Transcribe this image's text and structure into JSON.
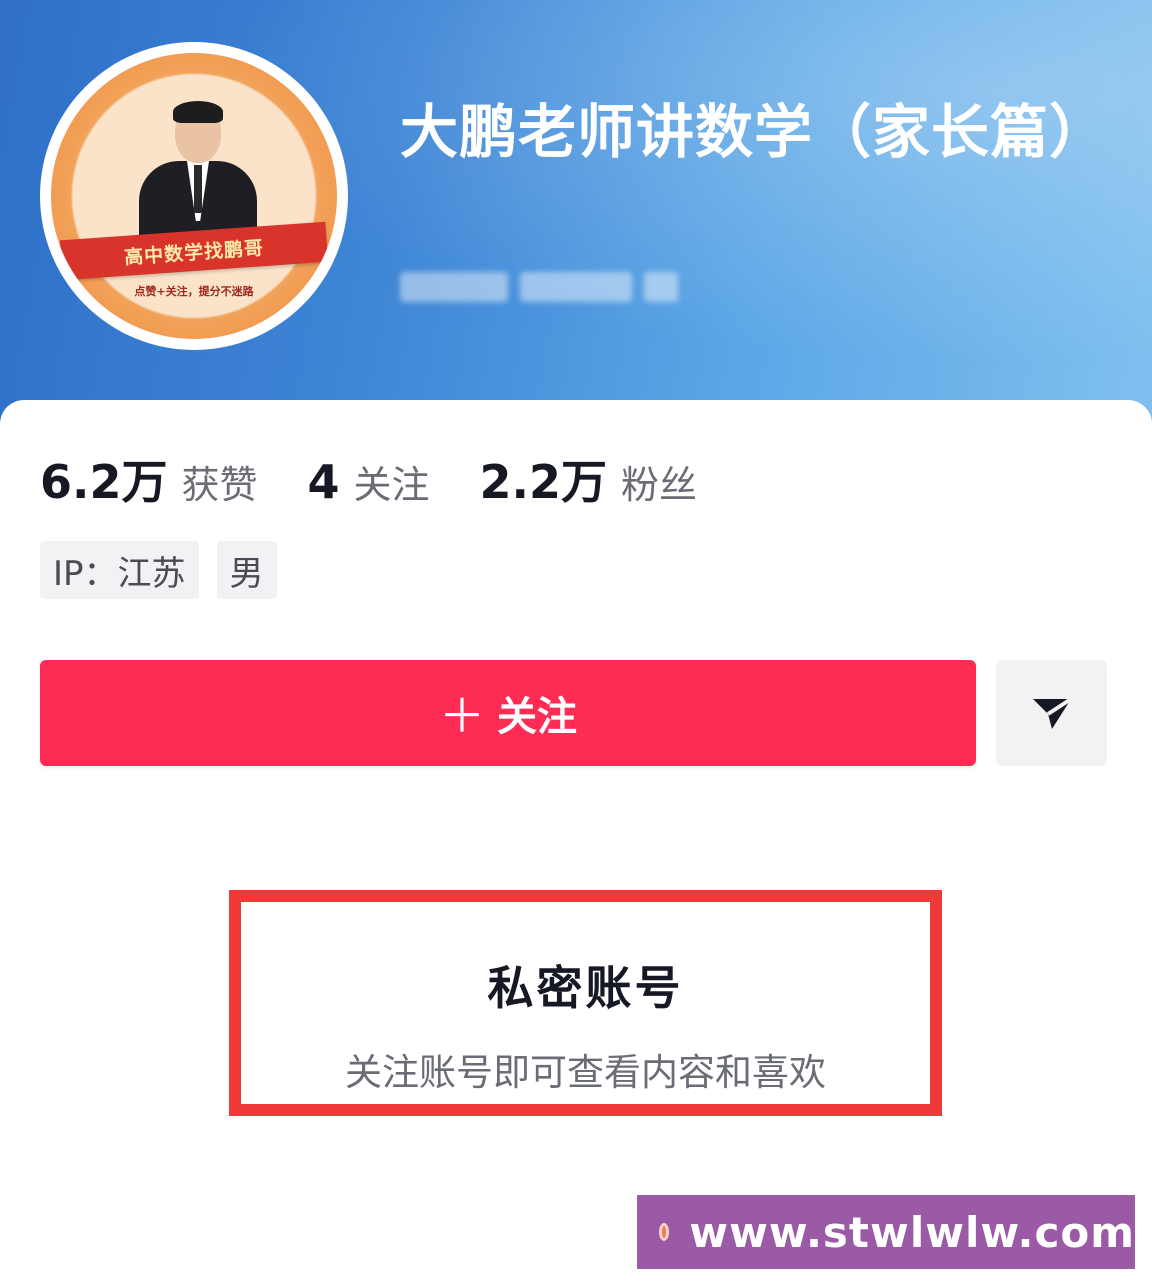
{
  "profile": {
    "name": "大鹏老师讲数学（家长篇）",
    "avatar_banner_text": "高中数学找鹏哥",
    "avatar_sub_text": "点赞+关注，提分不迷路"
  },
  "stats": [
    {
      "value": "6.2万",
      "label": "获赞"
    },
    {
      "value": "4",
      "label": "关注"
    },
    {
      "value": "2.2万",
      "label": "粉丝"
    }
  ],
  "tags": [
    {
      "text": "IP：江苏"
    },
    {
      "text": "男"
    }
  ],
  "actions": {
    "follow_label": "关注",
    "follow_plus": "＋",
    "share_icon": "send-icon"
  },
  "private_notice": {
    "title": "私密账号",
    "subtitle": "关注账号即可查看内容和喜欢",
    "highlight_color": "#f03a3a"
  },
  "watermark": {
    "text": "www.stwlwlw.com"
  },
  "colors": {
    "follow_button": "#fe2c55",
    "banner": "#3f86d6"
  }
}
